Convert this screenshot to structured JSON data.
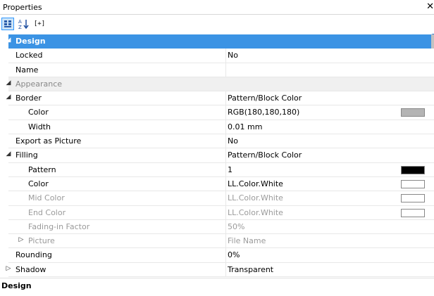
{
  "panel": {
    "title": "Properties",
    "close_glyph": "✕"
  },
  "toolbar": {
    "categorized_icon": "categorized-view-icon",
    "alpha_icon": "alphabetical-sort-icon",
    "expand_label": "[+]"
  },
  "rows": [
    {
      "name": "Design",
      "value": "",
      "toggle": "◢"
    },
    {
      "name": "Locked",
      "value": "No"
    },
    {
      "name": "Name",
      "value": ""
    },
    {
      "name": "Appearance",
      "value": "",
      "toggle": "◢"
    },
    {
      "name": "Border",
      "value": "Pattern/Block Color",
      "toggle": "◢"
    },
    {
      "name": "Color",
      "value": "RGB(180,180,180)",
      "swatch": "#b4b4b4"
    },
    {
      "name": "Width",
      "value": "0.01 mm"
    },
    {
      "name": "Export as Picture",
      "value": "No"
    },
    {
      "name": "Filling",
      "value": "Pattern/Block Color",
      "toggle": "◢"
    },
    {
      "name": "Pattern",
      "value": "1",
      "swatch": "#000000"
    },
    {
      "name": "Color",
      "value": "LL.Color.White",
      "swatch": "#ffffff"
    },
    {
      "name": "Mid Color",
      "value": "LL.Color.White",
      "swatch": "#ffffff"
    },
    {
      "name": "End Color",
      "value": "LL.Color.White",
      "swatch": "#ffffff"
    },
    {
      "name": "Fading-in Factor",
      "value": "50%"
    },
    {
      "name": "Picture",
      "value": "File Name",
      "toggle": "▷"
    },
    {
      "name": "Rounding",
      "value": "0%"
    },
    {
      "name": "Shadow",
      "value": "Transparent",
      "toggle": "▷"
    }
  ],
  "footer": {
    "label": "Design"
  },
  "colors": {
    "accent": "#3b93e4",
    "selected": "#cce4f7"
  }
}
